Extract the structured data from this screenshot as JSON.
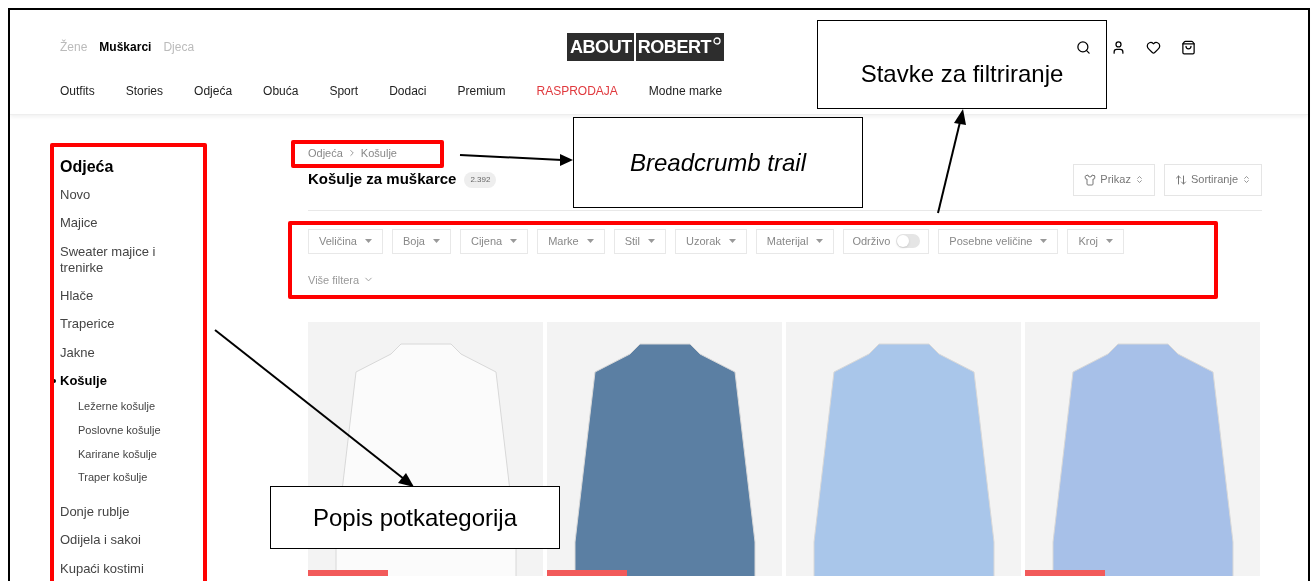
{
  "header": {
    "gender_tabs": [
      {
        "label": "Žene",
        "selected": false
      },
      {
        "label": "Muškarci",
        "selected": true
      },
      {
        "label": "Djeca",
        "selected": false
      }
    ],
    "logo": {
      "left": "ABOUT",
      "right": "ROBERT"
    },
    "nav": [
      {
        "label": "Outfits",
        "kind": "normal"
      },
      {
        "label": "Stories",
        "kind": "normal"
      },
      {
        "label": "Odjeća",
        "kind": "normal"
      },
      {
        "label": "Obuća",
        "kind": "normal"
      },
      {
        "label": "Sport",
        "kind": "normal"
      },
      {
        "label": "Dodaci",
        "kind": "normal"
      },
      {
        "label": "Premium",
        "kind": "normal"
      },
      {
        "label": "RASPRODAJA",
        "kind": "sale"
      },
      {
        "label": "Modne marke",
        "kind": "normal"
      }
    ]
  },
  "sidebar": {
    "title": "Odjeća",
    "items": [
      {
        "label": "Novo",
        "selected": false
      },
      {
        "label": "Majice",
        "selected": false
      },
      {
        "label": "Sweater majice i trenirke",
        "selected": false
      },
      {
        "label": "Hlače",
        "selected": false
      },
      {
        "label": "Traperice",
        "selected": false
      },
      {
        "label": "Jakne",
        "selected": false
      },
      {
        "label": "Košulje",
        "selected": true,
        "children": [
          {
            "label": "Ležerne košulje",
            "selected": false
          },
          {
            "label": "Poslovne košulje",
            "selected": false
          },
          {
            "label": "Karirane košulje",
            "selected": false
          },
          {
            "label": "Traper košulje",
            "selected": false
          }
        ]
      },
      {
        "label": "Donje rublje",
        "selected": false
      },
      {
        "label": "Odijela i sakoi",
        "selected": false
      },
      {
        "label": "Kupaći kostimi",
        "selected": false
      }
    ]
  },
  "breadcrumb": [
    "Odjeća",
    "Košulje"
  ],
  "title": "Košulje za muškarce",
  "count": "2.392",
  "view_buttons": [
    {
      "label": "Prikaz",
      "kind": "view"
    },
    {
      "label": "Sortiranje",
      "kind": "sort"
    }
  ],
  "filters": [
    {
      "label": "Veličina",
      "kind": "dropdown"
    },
    {
      "label": "Boja",
      "kind": "dropdown"
    },
    {
      "label": "Cijena",
      "kind": "dropdown"
    },
    {
      "label": "Marke",
      "kind": "dropdown"
    },
    {
      "label": "Stil",
      "kind": "dropdown"
    },
    {
      "label": "Uzorak",
      "kind": "dropdown"
    },
    {
      "label": "Materijal",
      "kind": "dropdown"
    },
    {
      "label": "Održivo",
      "kind": "toggle",
      "on": false
    },
    {
      "label": "Posebne veličine",
      "kind": "dropdown"
    },
    {
      "label": "Kroj",
      "kind": "dropdown"
    }
  ],
  "more_filters": "Više filtera",
  "products": [
    {
      "sale_badge": true
    },
    {
      "sale_badge": true
    },
    {
      "sale_badge": false
    },
    {
      "sale_badge": true
    }
  ],
  "annotations": [
    {
      "text": "Stavke za filtriranje",
      "italic": false
    },
    {
      "text": "Breadcrumb trail",
      "italic": true
    },
    {
      "text": "Popis potkategorija",
      "italic": false
    }
  ]
}
